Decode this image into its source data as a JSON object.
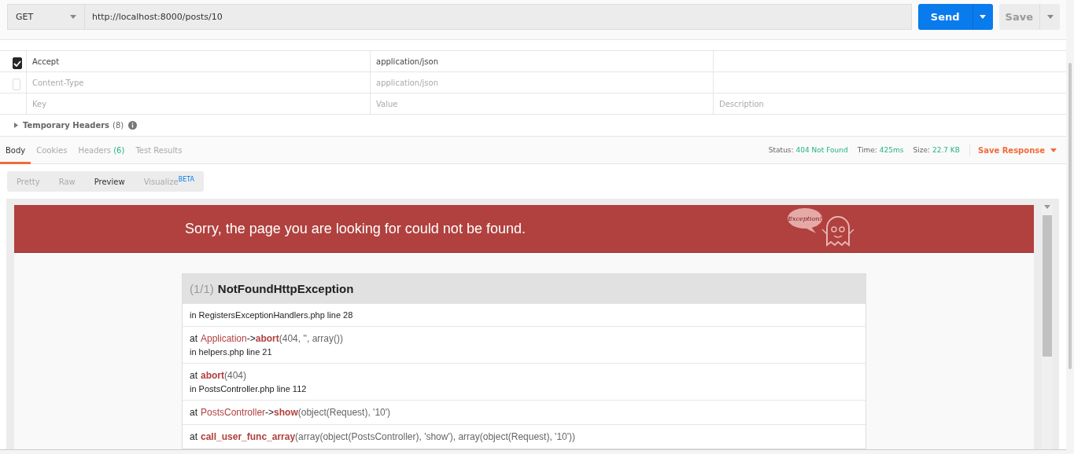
{
  "request": {
    "method": "GET",
    "url": "http://localhost:8000/posts/10",
    "send": "Send",
    "save": "Save"
  },
  "headers": [
    {
      "key": "Accept",
      "value": "application/json",
      "checked": true,
      "kind": "row"
    },
    {
      "key": "Content-Type",
      "value": "application/json",
      "checked": false,
      "kind": "row"
    },
    {
      "key": "Key",
      "value": "Value",
      "description": "Description",
      "kind": "placeholder"
    }
  ],
  "temporary_headers": {
    "label": "Temporary Headers",
    "count": "(8)",
    "expanded": false
  },
  "response_tabs": [
    {
      "label": "Body",
      "selected": true
    },
    {
      "label": "Cookies",
      "selected": false
    },
    {
      "label": "Headers",
      "count": "(6)",
      "selected": false
    },
    {
      "label": "Test Results",
      "selected": false
    }
  ],
  "status": [
    {
      "label": "Status:",
      "value": "404 Not Found"
    },
    {
      "label": "Time:",
      "value": "425ms"
    },
    {
      "label": "Size:",
      "value": "22.7 KB"
    }
  ],
  "save_response": "Save Response",
  "view_modes": [
    {
      "label": "Pretty",
      "selected": false
    },
    {
      "label": "Raw",
      "selected": false
    },
    {
      "label": "Preview",
      "selected": true
    },
    {
      "label": "Visualize",
      "badge": "BETA",
      "selected": false
    }
  ],
  "preview": {
    "banner": "Sorry, the page you are looking for could not be found.",
    "banner_art": "Exception!",
    "exception_count": "(1/1)",
    "exception_name": "NotFoundHttpException",
    "frames": [
      {
        "location": "in RegistersExceptionHandlers.php line 28"
      },
      {
        "parts": [
          {
            "kind": "plain",
            "text": "at"
          },
          {
            "kind": "class",
            "text": "Application"
          },
          {
            "kind": "plain",
            "text": "->"
          },
          {
            "kind": "method",
            "text": "abort"
          },
          {
            "kind": "args",
            "text": "(404, '', array())"
          }
        ],
        "location": "in helpers.php line 21"
      },
      {
        "parts": [
          {
            "kind": "plain",
            "text": "at"
          },
          {
            "kind": "method",
            "text": "abort"
          },
          {
            "kind": "args",
            "text": "(404)"
          }
        ],
        "location": "in PostsController.php line 112"
      },
      {
        "parts": [
          {
            "kind": "plain",
            "text": "at"
          },
          {
            "kind": "class",
            "text": "PostsController"
          },
          {
            "kind": "plain",
            "text": "->"
          },
          {
            "kind": "method",
            "text": "show"
          },
          {
            "kind": "args",
            "text": "(object(Request), '10')"
          }
        ]
      },
      {
        "parts": [
          {
            "kind": "plain",
            "text": "at"
          },
          {
            "kind": "method",
            "text": "call_user_func_array"
          },
          {
            "kind": "args",
            "text": "(array(object(PostsController), 'show'), array(object(Request), '10'))"
          }
        ]
      }
    ]
  }
}
